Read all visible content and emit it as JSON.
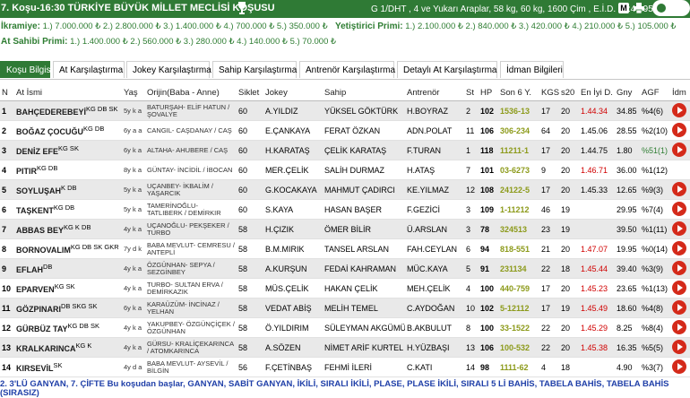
{
  "header": {
    "title": "7. Koşu-16:30 TÜRKİYE BÜYÜK MİLLET MECLİSİ KOŞUSU",
    "race_info": "G 1/DHT , 4 ve Yukarı Araplar, 58 kg, 60 kg, 1600 Çim , E.İ.D. : 1:43.95",
    "m_label": "M"
  },
  "prizes": {
    "ikramiye_label": "İkramiye:",
    "ikramiye": "1.) 7.000.000 ₺ 2.) 2.800.000 ₺ 3.) 1.400.000 ₺ 4.) 700.000 ₺ 5.) 350.000 ₺",
    "yetistirici_label": "Yetiştirici Primi:",
    "yetistirici": "1.) 2.100.000 ₺ 2.) 840.000 ₺ 3.) 420.000 ₺ 4.) 210.000 ₺ 5.) 105.000 ₺",
    "at_sahibi_label": "At Sahibi Primi:",
    "at_sahibi": "1.) 1.400.000 ₺ 2.) 560.000 ₺ 3.) 280.000 ₺ 4.) 140.000 ₺ 5.) 70.000 ₺"
  },
  "tabs": [
    "Koşu Bilgisi",
    "At Karşılaştırma",
    "Jokey Karşılaştırma",
    "Sahip Karşılaştırma",
    "Antrenör Karşılaştırma",
    "Detaylı At Karşılaştırma",
    "İdman Bilgileri"
  ],
  "columns": [
    "N",
    "At İsmi",
    "Yaş",
    "Orijin(Baba - Anne)",
    "Siklet",
    "Jokey",
    "Sahip",
    "Antrenör",
    "St",
    "HP",
    "Son 6 Y.",
    "KGS",
    "s20",
    "En İyi D.",
    "Gny",
    "AGF",
    "İdm"
  ],
  "rows": [
    {
      "n": "1",
      "name": "BAHÇEDEREBEYİ",
      "tags": "KG DB SK",
      "age": "5y k a",
      "origin": "BATURŞAH- ELİF HATUN / ŞOVALYE",
      "weight": "60",
      "jockey": "A.YILDIZ",
      "owner": "YÜKSEL GÖKTÜRK",
      "trainer": "H.BOYRAZ",
      "st": "2",
      "hp": "102",
      "form": "1536-13",
      "kgs": "17",
      "s20": "20",
      "best": "1.44.34",
      "best_red": true,
      "gny": "34.85",
      "agf": "%4(6)",
      "agf_green": false,
      "idm": true
    },
    {
      "n": "2",
      "name": "BOĞAZ ÇOCUĞU",
      "tags": "KG DB",
      "age": "6y a a",
      "origin": "CANGIL- CAŞDANAY / CAŞ",
      "weight": "60",
      "jockey": "E.ÇANKAYA",
      "owner": "FERAT ÖZKAN",
      "trainer": "ADN.POLAT",
      "st": "11",
      "hp": "106",
      "form": "306-234",
      "kgs": "64",
      "s20": "20",
      "best": "1.45.06",
      "best_red": false,
      "gny": "28.55",
      "agf": "%2(10)",
      "agf_green": false,
      "idm": true
    },
    {
      "n": "3",
      "name": "DENİZ EFE",
      "tags": "KG SK",
      "age": "6y k a",
      "origin": "ALTAHA- AHUBERE / CAŞ",
      "weight": "60",
      "jockey": "H.KARATAŞ",
      "owner": "ÇELİK KARATAŞ",
      "trainer": "F.TURAN",
      "st": "1",
      "hp": "118",
      "form": "11211-1",
      "kgs": "17",
      "s20": "20",
      "best": "1.44.75",
      "best_red": false,
      "gny": "1.80",
      "agf": "%51(1)",
      "agf_green": true,
      "idm": true
    },
    {
      "n": "4",
      "name": "PITIR",
      "tags": "KG DB",
      "age": "8y k a",
      "origin": "GÜNTAY- İNCİDİL / İBOCAN",
      "weight": "60",
      "jockey": "MER.ÇELİK",
      "owner": "SALİH DURMAZ",
      "trainer": "H.ATAŞ",
      "st": "7",
      "hp": "101",
      "form": "03-6273",
      "kgs": "9",
      "s20": "20",
      "best": "1.46.71",
      "best_red": true,
      "gny": "36.00",
      "agf": "%1(12)",
      "agf_green": false,
      "idm": false
    },
    {
      "n": "5",
      "name": "SOYLUŞAH",
      "tags": "K DB",
      "age": "5y k a",
      "origin": "UÇANBEY- İKBALİM / YAŞARCIK",
      "weight": "60",
      "jockey": "G.KOCAKAYA",
      "owner": "MAHMUT ÇADIRCI",
      "trainer": "KE.YILMAZ",
      "st": "12",
      "hp": "108",
      "form": "24122-5",
      "kgs": "17",
      "s20": "20",
      "best": "1.45.33",
      "best_red": false,
      "gny": "12.65",
      "agf": "%9(3)",
      "agf_green": false,
      "idm": true
    },
    {
      "n": "6",
      "name": "TAŞKENT",
      "tags": "KG DB",
      "age": "5y k a",
      "origin": "TAMERİNOĞLU- TATLIBERK / DEMİRKIR",
      "weight": "60",
      "jockey": "S.KAYA",
      "owner": "HASAN BAŞER",
      "trainer": "F.GEZİCİ",
      "st": "3",
      "hp": "109",
      "form": "1-11212",
      "kgs": "46",
      "s20": "19",
      "best": "",
      "best_red": false,
      "gny": "29.95",
      "agf": "%7(4)",
      "agf_green": false,
      "idm": true
    },
    {
      "n": "7",
      "name": "ABBAS BEY",
      "tags": "KG K DB",
      "age": "4y k a",
      "origin": "UÇANOĞLU- PEKŞEKER / TURBO",
      "weight": "58",
      "jockey": "H.ÇIZIK",
      "owner": "ÖMER BİLİR",
      "trainer": "Ü.ARSLAN",
      "st": "3",
      "hp": "78",
      "form": "324513",
      "kgs": "23",
      "s20": "19",
      "best": "",
      "best_red": false,
      "gny": "39.50",
      "agf": "%1(11)",
      "agf_green": false,
      "idm": true
    },
    {
      "n": "8",
      "name": "BORNOVALIM",
      "tags": "KG DB SK GKR",
      "age": "7y d k",
      "origin": "BABA MEVLUT- CEMRESU / ANTEPLİ",
      "weight": "58",
      "jockey": "B.M.MIRIK",
      "owner": "TANSEL ARSLAN",
      "trainer": "FAH.CEYLAN",
      "st": "6",
      "hp": "94",
      "form": "818-551",
      "kgs": "21",
      "s20": "20",
      "best": "1.47.07",
      "best_red": true,
      "gny": "19.95",
      "agf": "%0(14)",
      "agf_green": false,
      "idm": true
    },
    {
      "n": "9",
      "name": "EFLAH",
      "tags": "DB",
      "age": "4y k a",
      "origin": "ÖZGÜNHAN- SEPYA / SEZGİNBEY",
      "weight": "58",
      "jockey": "A.KURŞUN",
      "owner": "FEDAİ KAHRAMAN",
      "trainer": "MÜC.KAYA",
      "st": "5",
      "hp": "91",
      "form": "231134",
      "kgs": "22",
      "s20": "18",
      "best": "1.45.44",
      "best_red": true,
      "gny": "39.40",
      "agf": "%3(9)",
      "agf_green": false,
      "idm": true
    },
    {
      "n": "10",
      "name": "EPARVEN",
      "tags": "KG SK",
      "age": "4y k a",
      "origin": "TURBO- SULTAN ERVA / DEMİRKAZIK",
      "weight": "58",
      "jockey": "MÜS.ÇELİK",
      "owner": "HAKAN ÇELİK",
      "trainer": "MEH.ÇELİK",
      "st": "4",
      "hp": "100",
      "form": "440-759",
      "kgs": "17",
      "s20": "20",
      "best": "1.45.23",
      "best_red": true,
      "gny": "23.65",
      "agf": "%1(13)",
      "agf_green": false,
      "idm": true
    },
    {
      "n": "11",
      "name": "GÖZPINARI",
      "tags": "DB SKG SK",
      "age": "6y k a",
      "origin": "KARAÜZÜM- İNCİNAZ / YELHAN",
      "weight": "58",
      "jockey": "VEDAT ABİŞ",
      "owner": "MELİH TEMEL",
      "trainer": "C.AYDOĞAN",
      "st": "10",
      "hp": "102",
      "form": "5-12112",
      "kgs": "17",
      "s20": "19",
      "best": "1.45.49",
      "best_red": true,
      "gny": "18.60",
      "agf": "%4(8)",
      "agf_green": false,
      "idm": true
    },
    {
      "n": "12",
      "name": "GÜRBÜZ TAY",
      "tags": "KG DB SK",
      "age": "4y k a",
      "origin": "YAKUPBEY- ÖZGÜNÇİÇEK / ÖZGÜNHAN",
      "weight": "58",
      "jockey": "Ö.YILDIRIM",
      "owner": "SÜLEYMAN AKGÜMÜŞ",
      "trainer": "B.AKBULUT",
      "st": "8",
      "hp": "100",
      "form": "33-1522",
      "kgs": "22",
      "s20": "20",
      "best": "1.45.29",
      "best_red": true,
      "gny": "8.25",
      "agf": "%8(4)",
      "agf_green": false,
      "idm": true
    },
    {
      "n": "13",
      "name": "KRALKARINCA",
      "tags": "KG K",
      "age": "4y k a",
      "origin": "GÜRSU- KRALİÇEKARINCA / ATOMKARINCA",
      "weight": "58",
      "jockey": "A.SÖZEN",
      "owner": "NİMET ARİF KURTEL",
      "trainer": "H.YÜZBAŞI",
      "st": "13",
      "hp": "106",
      "form": "100-532",
      "kgs": "22",
      "s20": "20",
      "best": "1.45.38",
      "best_red": true,
      "gny": "16.35",
      "agf": "%5(5)",
      "agf_green": false,
      "idm": true
    },
    {
      "n": "14",
      "name": "KIRSEVİL",
      "tags": "SK",
      "age": "4y d a",
      "origin": "BABA MEVLUT- AYSEVİL / BİLGİN",
      "weight": "56",
      "jockey": "F.ÇETİNBAŞ",
      "owner": "FEHMİ İLERİ",
      "trainer": "C.KATI",
      "st": "14",
      "hp": "98",
      "form": "1111-62",
      "kgs": "4",
      "s20": "18",
      "best": "",
      "best_red": false,
      "gny": "4.90",
      "agf": "%3(7)",
      "agf_green": false,
      "idm": true
    }
  ],
  "footer_note": "2. 3'LÜ GANYAN, 7. ÇİFTE Bu koşudan başlar, GANYAN, SABİT GANYAN, İKİLİ, SIRALI İKİLİ, PLASE, PLASE İKİLİ, SIRALI 5 Lİ BAHİS, TABELA BAHİS, TABELA BAHİS (SIRASIZ)",
  "colors": {
    "brand_green": "#2f7a35",
    "idm_button": "#d42a1a",
    "note_blue": "#1f3fa8"
  }
}
